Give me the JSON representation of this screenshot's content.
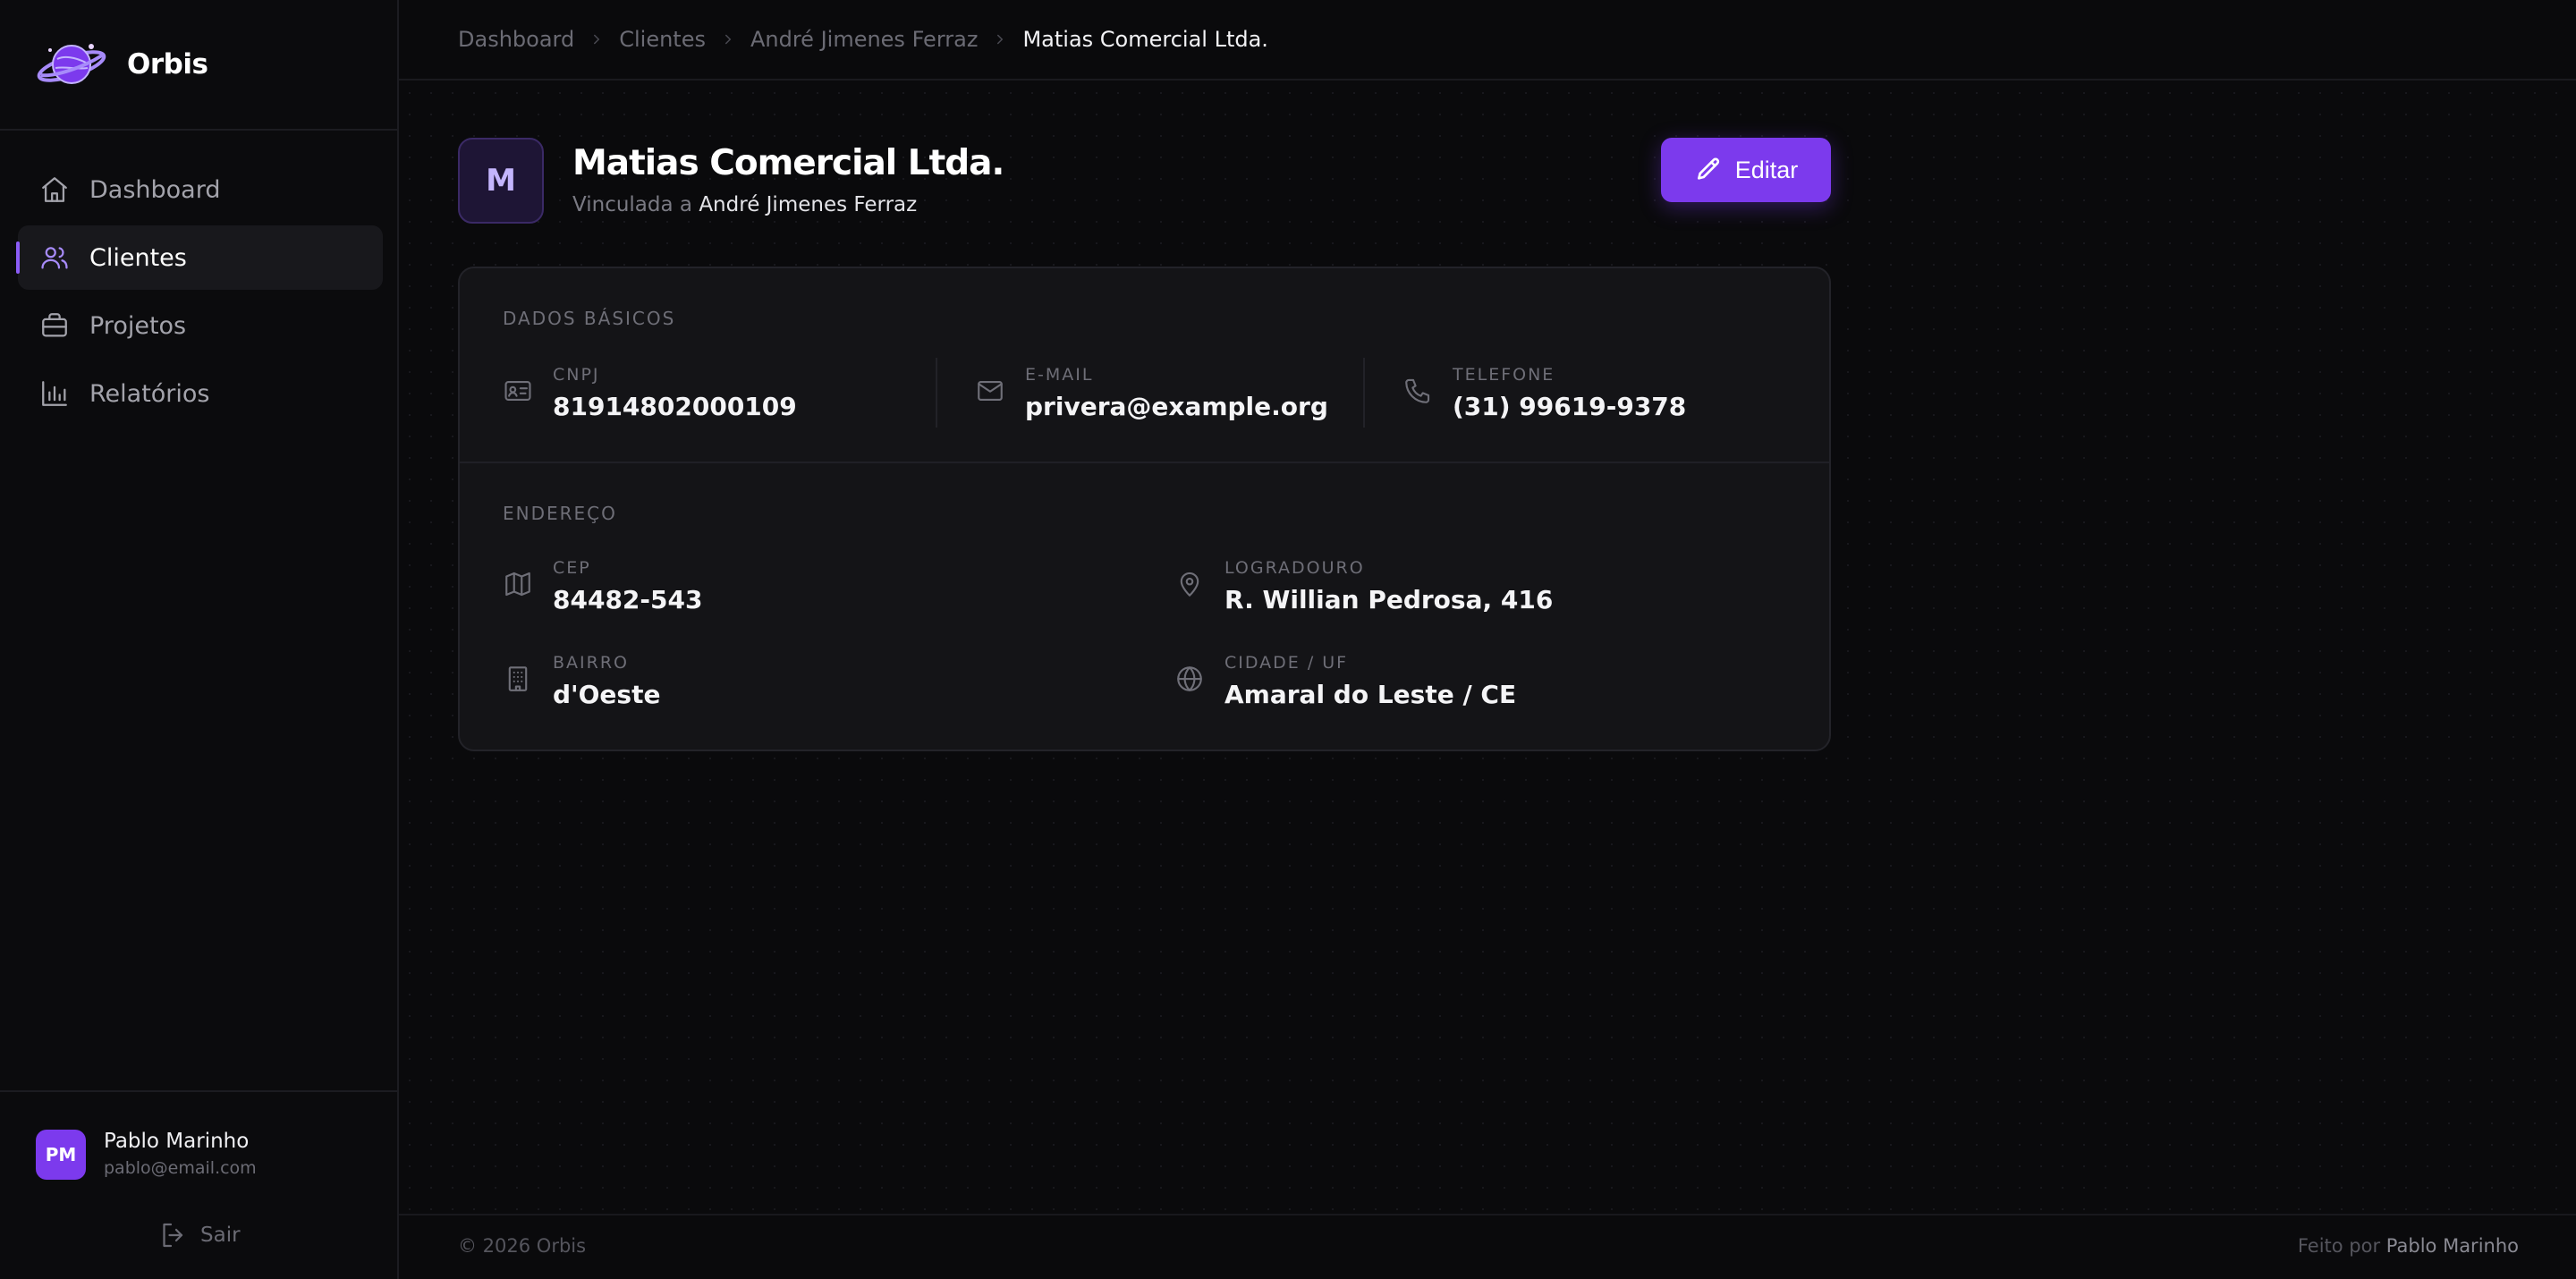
{
  "app": {
    "name": "Orbis",
    "accent_color": "#7c3aed",
    "logo_icon": "planet-icon"
  },
  "sidebar": {
    "items": [
      {
        "label": "Dashboard",
        "icon": "home-icon",
        "active": false
      },
      {
        "label": "Clientes",
        "icon": "users-icon",
        "active": true
      },
      {
        "label": "Projetos",
        "icon": "briefcase-icon",
        "active": false
      },
      {
        "label": "Relatórios",
        "icon": "bar-chart-icon",
        "active": false
      }
    ],
    "user": {
      "initials": "PM",
      "name": "Pablo Marinho",
      "email": "pablo@email.com"
    },
    "logout_label": "Sair"
  },
  "breadcrumb": [
    "Dashboard",
    "Clientes",
    "André Jimenes Ferraz",
    "Matias Comercial Ltda."
  ],
  "header": {
    "avatar_letter": "M",
    "title": "Matias Comercial Ltda.",
    "subtitle_prefix": "Vinculada a",
    "subtitle_link": "André Jimenes Ferraz",
    "edit_label": "Editar"
  },
  "basic_data": {
    "section_label": "DADOS BÁSICOS",
    "cnpj": {
      "label": "CNPJ",
      "value": "81914802000109",
      "icon": "id-card-icon"
    },
    "email": {
      "label": "E-MAIL",
      "value": "privera@example.org",
      "icon": "mail-icon"
    },
    "phone": {
      "label": "TELEFONE",
      "value": "(31) 99619-9378",
      "icon": "phone-icon"
    }
  },
  "address": {
    "section_label": "ENDEREÇO",
    "cep": {
      "label": "CEP",
      "value": "84482-543",
      "icon": "map-icon"
    },
    "street": {
      "label": "LOGRADOURO",
      "value": "R. Willian Pedrosa, 416",
      "icon": "map-pin-icon"
    },
    "district": {
      "label": "BAIRRO",
      "value": "d'Oeste",
      "icon": "building-icon"
    },
    "city": {
      "label": "CIDADE / UF",
      "value": "Amaral do Leste / CE",
      "icon": "globe-icon"
    }
  },
  "footer": {
    "copyright": "© 2026 Orbis",
    "made_by_prefix": "Feito por",
    "made_by_author": "Pablo Marinho"
  }
}
